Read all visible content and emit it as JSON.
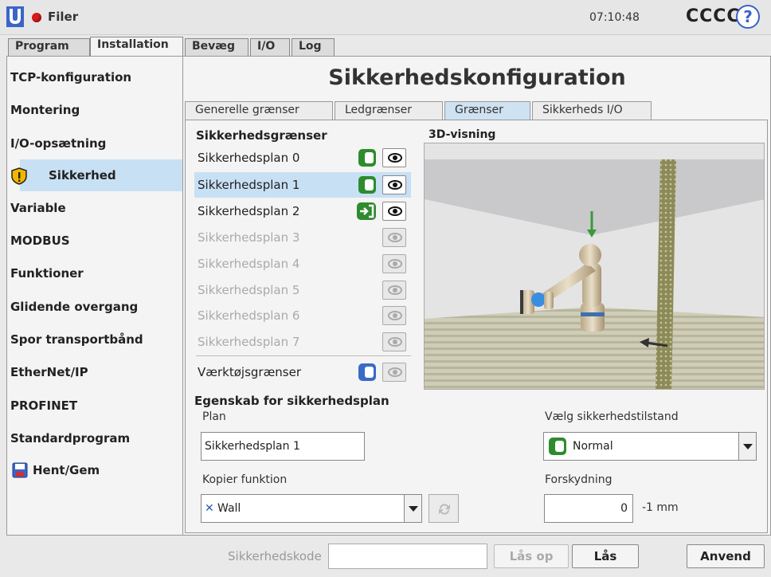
{
  "topbar": {
    "title": "Filer",
    "time": "07:10:48",
    "user": "CCCC",
    "help": "?"
  },
  "main_tabs": [
    {
      "label": "Program"
    },
    {
      "label": "Installation"
    },
    {
      "label": "Bevæg"
    },
    {
      "label": "I/O"
    },
    {
      "label": "Log"
    }
  ],
  "sidebar": {
    "items": [
      {
        "label": "TCP-konfiguration"
      },
      {
        "label": "Montering"
      },
      {
        "label": "I/O-opsætning"
      },
      {
        "label": "Sikkerhed",
        "icon": "warning-shield-icon"
      },
      {
        "label": "Variable"
      },
      {
        "label": "MODBUS"
      },
      {
        "label": "Funktioner"
      },
      {
        "label": "Glidende overgang"
      },
      {
        "label": "Spor transportbånd"
      },
      {
        "label": "EtherNet/IP"
      },
      {
        "label": "PROFINET"
      },
      {
        "label": "Standardprogram"
      },
      {
        "label": "Hent/Gem",
        "icon": "save-icon"
      }
    ]
  },
  "page_title": "Sikkerhedskonfiguration",
  "sub_tabs": [
    {
      "label": "Generelle grænser"
    },
    {
      "label": "Ledgrænser"
    },
    {
      "label": "Grænser"
    },
    {
      "label": "Sikkerheds I/O"
    }
  ],
  "limits": {
    "section_label": "Sikkerhedsgrænser",
    "planes": [
      {
        "label": "Sikkerhedsplan 0"
      },
      {
        "label": "Sikkerhedsplan 1"
      },
      {
        "label": "Sikkerhedsplan 2"
      },
      {
        "label": "Sikkerhedsplan 3"
      },
      {
        "label": "Sikkerhedsplan 4"
      },
      {
        "label": "Sikkerhedsplan 5"
      },
      {
        "label": "Sikkerhedsplan 6"
      },
      {
        "label": "Sikkerhedsplan 7"
      }
    ],
    "tool_limits_label": "Værktøjsgrænser"
  },
  "view3d": {
    "label": "3D-visning"
  },
  "property": {
    "section_label": "Egenskab for sikkerhedsplan",
    "plan_label": "Plan",
    "plan_value": "Sikkerhedsplan 1",
    "copy_label": "Kopier funktion",
    "copy_value": "Wall",
    "mode_label": "Vælg sikkerhedstilstand",
    "mode_value": "Normal",
    "offset_label": "Forskydning",
    "offset_value": "0",
    "offset_unit": "-1 mm"
  },
  "bottom": {
    "code_label": "Sikkerhedskode",
    "unlock_label": "Lås op",
    "lock_label": "Lås",
    "apply_label": "Anvend"
  },
  "colors": {
    "accent_blue": "#3a6ac6",
    "selection": "#c8e0f4",
    "toggle_green": "#2e8b2e"
  }
}
